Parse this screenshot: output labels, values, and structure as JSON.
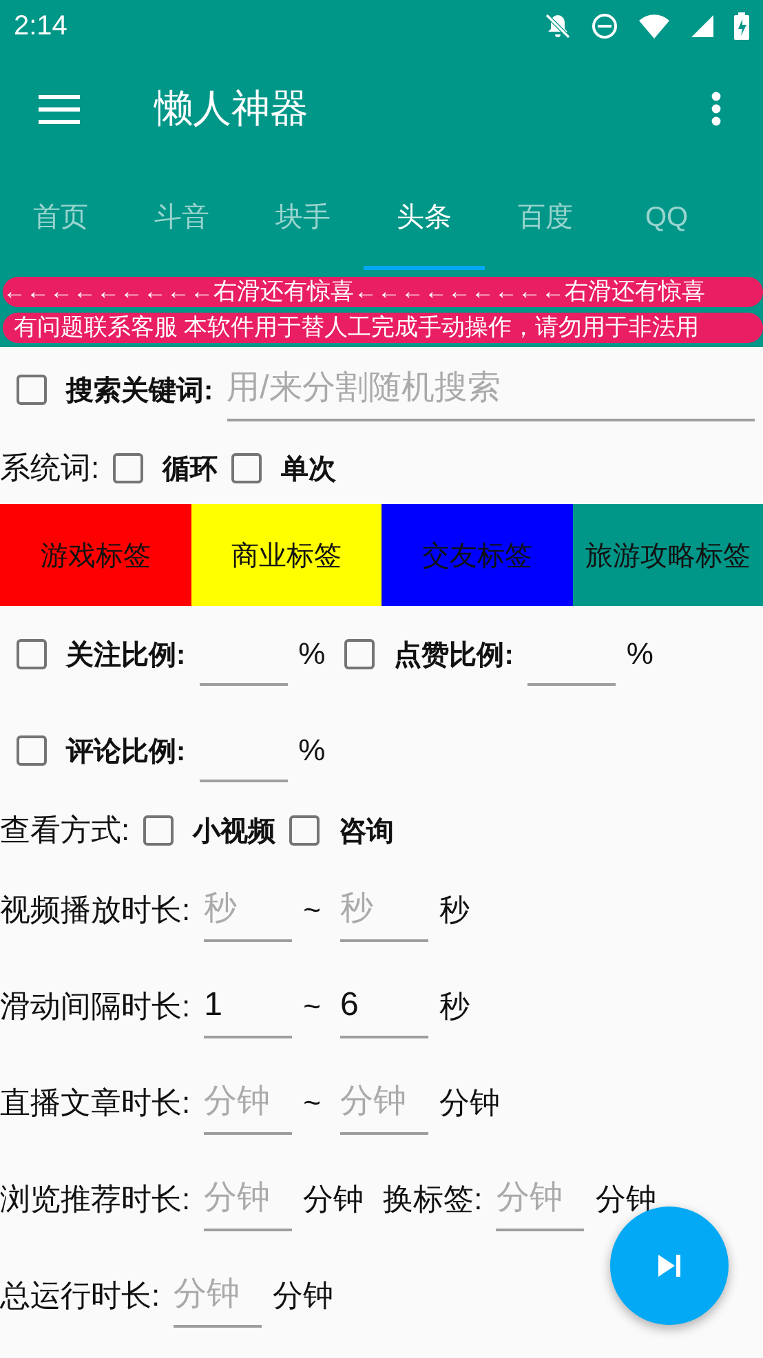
{
  "status_bar": {
    "time": "2:14"
  },
  "toolbar": {
    "title": "懒人神器"
  },
  "tabs": [
    {
      "label": "首页",
      "selected": false
    },
    {
      "label": "斗音",
      "selected": false
    },
    {
      "label": "块手",
      "selected": false
    },
    {
      "label": "头条",
      "selected": true
    },
    {
      "label": "百度",
      "selected": false
    },
    {
      "label": "QQ",
      "selected": false
    }
  ],
  "banners": [
    "←←←←←←←←←右滑还有惊喜←←←←←←←←←右滑还有惊喜",
    "有问题联系客服 本软件用于替人工完成手动操作，请勿用于非法用"
  ],
  "form": [
    {
      "kind": "fields",
      "parts": [
        {
          "kind": "check",
          "label": "搜索关键词:",
          "checked": false
        },
        {
          "kind": "search",
          "placeholder": "用/来分割随机搜索"
        }
      ]
    },
    {
      "kind": "fields",
      "parts": [
        {
          "kind": "label",
          "text": "系统词:"
        },
        {
          "kind": "check",
          "label": "循环",
          "checked": false
        },
        {
          "kind": "check",
          "label": "单次",
          "checked": false
        }
      ]
    },
    {
      "kind": "tags",
      "tags": [
        {
          "label": "游戏标签",
          "color": "#ff0000"
        },
        {
          "label": "商业标签",
          "color": "#ffff00"
        },
        {
          "label": "交友标签",
          "color": "#0000ff"
        },
        {
          "label": "旅游攻略标签",
          "color": "#009688"
        }
      ]
    },
    {
      "kind": "fields",
      "parts": [
        {
          "kind": "check",
          "label": "关注比例:",
          "checked": false
        },
        {
          "kind": "input"
        },
        {
          "kind": "unit",
          "text": "%"
        },
        {
          "kind": "check",
          "label": "点赞比例:",
          "checked": false
        },
        {
          "kind": "input"
        },
        {
          "kind": "unit",
          "text": "%"
        }
      ]
    },
    {
      "kind": "fields",
      "parts": [
        {
          "kind": "check",
          "label": "评论比例:",
          "checked": false
        },
        {
          "kind": "input"
        },
        {
          "kind": "unit",
          "text": "%"
        }
      ]
    },
    {
      "kind": "fields",
      "parts": [
        {
          "kind": "label",
          "text": "查看方式:"
        },
        {
          "kind": "check",
          "label": "小视频",
          "checked": false
        },
        {
          "kind": "check",
          "label": "咨询",
          "checked": false
        }
      ]
    },
    {
      "kind": "fields",
      "parts": [
        {
          "kind": "label",
          "text": "视频播放时长:"
        },
        {
          "kind": "input",
          "placeholder": "秒"
        },
        {
          "kind": "unit",
          "text": "~"
        },
        {
          "kind": "input",
          "placeholder": "秒"
        },
        {
          "kind": "unit",
          "text": "秒"
        }
      ]
    },
    {
      "kind": "fields",
      "parts": [
        {
          "kind": "label",
          "text": "滑动间隔时长:"
        },
        {
          "kind": "input",
          "value": "1"
        },
        {
          "kind": "unit",
          "text": "~"
        },
        {
          "kind": "input",
          "value": "6"
        },
        {
          "kind": "unit",
          "text": "秒"
        }
      ]
    },
    {
      "kind": "fields",
      "parts": [
        {
          "kind": "label",
          "text": "直播文章时长:"
        },
        {
          "kind": "input",
          "placeholder": "分钟"
        },
        {
          "kind": "unit",
          "text": "~"
        },
        {
          "kind": "input",
          "placeholder": "分钟"
        },
        {
          "kind": "unit",
          "text": "分钟"
        }
      ]
    },
    {
      "kind": "fields",
      "parts": [
        {
          "kind": "label",
          "text": "浏览推荐时长:"
        },
        {
          "kind": "input",
          "placeholder": "分钟"
        },
        {
          "kind": "unit",
          "text": "分钟"
        },
        {
          "kind": "label",
          "text": "换标签:"
        },
        {
          "kind": "input",
          "placeholder": "分钟"
        },
        {
          "kind": "unit",
          "text": "分钟"
        }
      ]
    },
    {
      "kind": "fields",
      "parts": [
        {
          "kind": "label",
          "text": "总运行时长:"
        },
        {
          "kind": "input",
          "placeholder": "分钟"
        },
        {
          "kind": "unit",
          "text": "分钟"
        }
      ]
    }
  ]
}
